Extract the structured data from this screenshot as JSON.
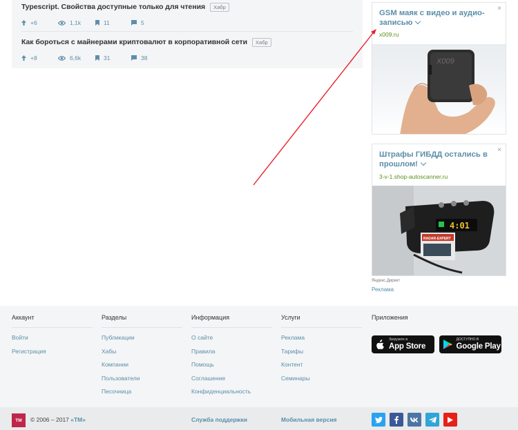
{
  "posts": [
    {
      "title": "Typescript. Свойства доступные только для чтения",
      "hub": "Хабр",
      "rating": "+6",
      "views": "1,1k",
      "bookmarks": "11",
      "comments": "5"
    },
    {
      "title": "Как бороться с майнерами криптовалют в корпоративной сети",
      "hub": "Хабр",
      "rating": "+8",
      "views": "6,6k",
      "bookmarks": "31",
      "comments": "38"
    }
  ],
  "ads": [
    {
      "title": "GSM маяк с видео и аудио-записью",
      "domain": "x009.ru",
      "close": "×",
      "image_text": "X009"
    },
    {
      "title": "Штрафы ГИБДД остались в прошлом!",
      "domain": "3-v-1.shop-autoscanner.ru",
      "close": "×",
      "image_text": "4:01",
      "image_sub": "RADAR-EXPERT"
    }
  ],
  "direct": {
    "label": "Яндекс.Директ",
    "ad_link": "Реклама"
  },
  "footer": {
    "columns": [
      {
        "heading": "Аккаунт",
        "links": [
          "Войти",
          "Регистрация"
        ]
      },
      {
        "heading": "Разделы",
        "links": [
          "Публикации",
          "Хабы",
          "Компании",
          "Пользователи",
          "Песочница"
        ]
      },
      {
        "heading": "Информация",
        "links": [
          "О сайте",
          "Правила",
          "Помощь",
          "Соглашение",
          "Конфиденциальность"
        ]
      },
      {
        "heading": "Услуги",
        "links": [
          "Реклама",
          "Тарифы",
          "Контент",
          "Семинары"
        ]
      },
      {
        "heading": "Приложения"
      }
    ],
    "app_store": {
      "small": "Загрузите в",
      "big": "App Store"
    },
    "google_play": {
      "small": "ДОСТУПНО В",
      "big": "Google Play"
    },
    "logo_text": "TM",
    "copyright": "© 2006 – 2017 ",
    "copyright_link": "«TM»",
    "support": "Служба поддержки",
    "mobile": "Мобильная версия"
  },
  "colors": {
    "link": "#5a8ea9",
    "ad_domain": "#5a8f18",
    "tm_brand": "#c0264b",
    "arrow": "#e8202a",
    "twitter": "#2aa3ef",
    "facebook": "#3b5998",
    "vk": "#4c75a3",
    "telegram": "#2fa5d8",
    "youtube": "#e62117"
  }
}
